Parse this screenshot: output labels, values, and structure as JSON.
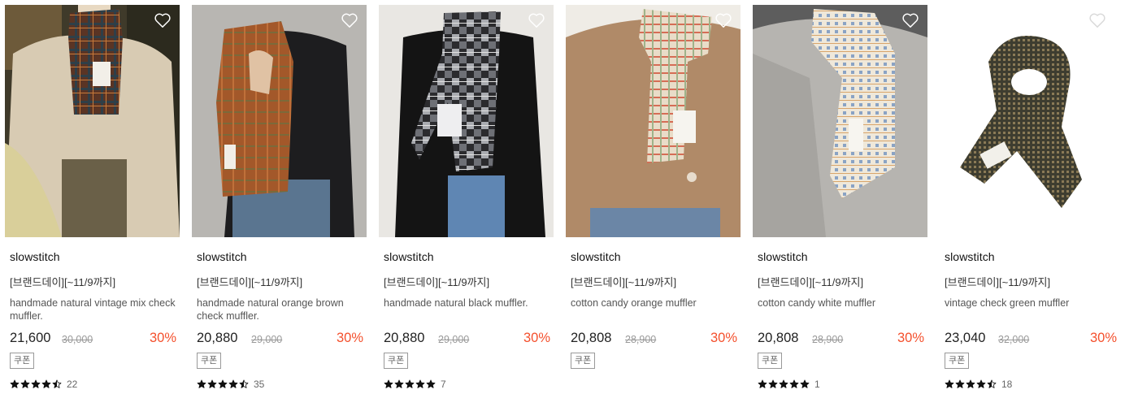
{
  "colors": {
    "discount": "#f4502d",
    "star": "#111111",
    "heart_outline": "#ffffff"
  },
  "products": [
    {
      "brand": "slowstitch",
      "promo": "[브랜드데이][~11/9까지]",
      "name": "handmade natural vintage mix check muffler.",
      "price": "21,600",
      "original_price": "30,000",
      "discount": "30%",
      "coupon": "쿠폰",
      "rating": 4.5,
      "review_count": "22",
      "image": "woman-wearing-brown-check-scarf-photo"
    },
    {
      "brand": "slowstitch",
      "promo": "[브랜드데이][~11/9까지]",
      "name": "handmade natural orange brown check muffler.",
      "price": "20,880",
      "original_price": "29,000",
      "discount": "30%",
      "coupon": "쿠폰",
      "rating": 4.5,
      "review_count": "35",
      "image": "woman-wearing-orange-brown-scarf-photo"
    },
    {
      "brand": "slowstitch",
      "promo": "[브랜드데이][~11/9까지]",
      "name": "handmade natural black muffler.",
      "price": "20,880",
      "original_price": "29,000",
      "discount": "30%",
      "coupon": "쿠폰",
      "rating": 5,
      "review_count": "7",
      "image": "woman-wearing-black-check-scarf-photo"
    },
    {
      "brand": "slowstitch",
      "promo": "[브랜드데이][~11/9까지]",
      "name": "cotton candy orange muffler",
      "price": "20,808",
      "original_price": "28,900",
      "discount": "30%",
      "coupon": "쿠폰",
      "rating": null,
      "review_count": null,
      "image": "woman-wearing-orange-check-scarf-photo"
    },
    {
      "brand": "slowstitch",
      "promo": "[브랜드데이][~11/9까지]",
      "name": "cotton candy white muffler",
      "price": "20,808",
      "original_price": "28,900",
      "discount": "30%",
      "coupon": "쿠폰",
      "rating": 5,
      "review_count": "1",
      "image": "woman-wearing-white-blue-scarf-photo"
    },
    {
      "brand": "slowstitch",
      "promo": "[브랜드데이][~11/9까지]",
      "name": "vintage check green muffler",
      "price": "23,040",
      "original_price": "32,000",
      "discount": "30%",
      "coupon": "쿠폰",
      "rating": 4.5,
      "review_count": "18",
      "image": "green-check-scarf-product-photo"
    }
  ]
}
